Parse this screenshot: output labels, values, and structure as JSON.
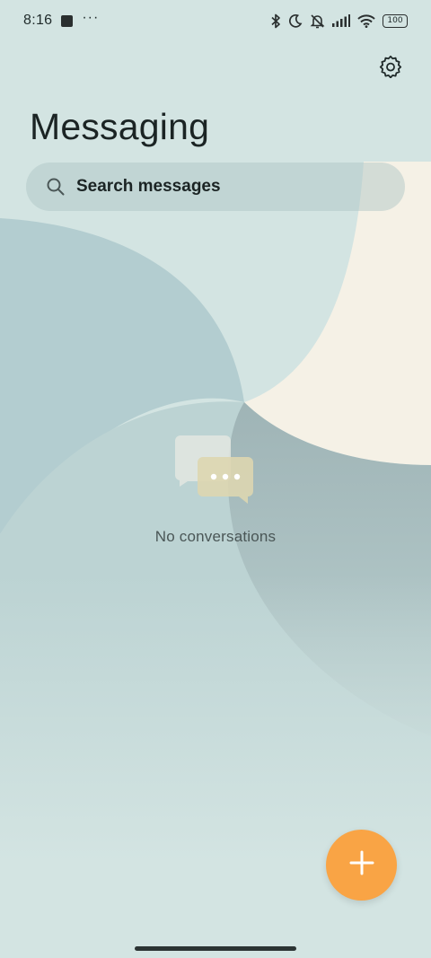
{
  "status_bar": {
    "time": "8:16",
    "more_indicator": "···",
    "battery_level": "100",
    "icons": [
      "app-notification-icon",
      "bluetooth-icon",
      "do-not-disturb-moon-icon",
      "silent-bell-icon",
      "signal-icon",
      "wifi-icon",
      "battery-icon"
    ]
  },
  "header": {
    "title": "Messaging",
    "settings_icon": "gear-icon"
  },
  "search": {
    "placeholder": "Search messages",
    "icon": "search-icon"
  },
  "empty_state": {
    "icon": "chat-bubbles-icon",
    "message": "No conversations"
  },
  "fab": {
    "icon": "plus-icon",
    "color": "#f9a445"
  },
  "colors": {
    "background": "#d3e4e2",
    "accent": "#f9a445",
    "cream_shape": "#f5f1e6"
  }
}
